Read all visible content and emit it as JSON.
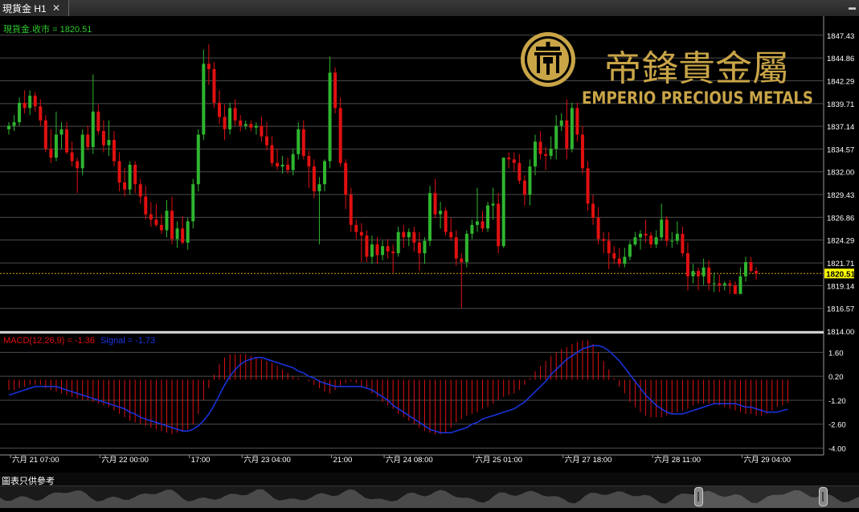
{
  "window": {
    "tab_title": "現貨金 H1",
    "close_glyph": "✕",
    "menu_glyph": "▬"
  },
  "price_panel": {
    "legend_label": "現貨金.收市 = 1820.51",
    "last_price_tag": "1820.51",
    "colors": {
      "up": "#2fb52f",
      "down": "#e01010",
      "grid": "#4d4d4d",
      "axis_text": "#ffffff",
      "last_line": "#d9a400",
      "tag_bg": "#ffff00"
    }
  },
  "logo": {
    "chinese": "帝鋒貴金屬",
    "english": "EMPERIO PRECIOUS METALS",
    "emblem_icon": "emperio-emblem-icon"
  },
  "macd_panel": {
    "legend_macd": "MACD(12,26,9) = -1.36",
    "legend_signal": "Signal = -1.73",
    "colors": {
      "histogram": "#e01010",
      "signal": "#1a35e6"
    }
  },
  "footer": {
    "disclaimer": "圖表只供參考"
  },
  "chart_data": [
    {
      "type": "candlestick",
      "title": "現貨金 H1",
      "y_ticks": [
        1814.0,
        1816.57,
        1819.14,
        1821.71,
        1824.29,
        1826.86,
        1829.43,
        1832.0,
        1834.57,
        1837.14,
        1839.71,
        1842.29,
        1844.86,
        1847.43
      ],
      "ylim": [
        1814.0,
        1848.5
      ],
      "last_price": 1820.51,
      "x_labels": [
        "六月 21 07:00",
        "六月 22 00:00",
        "17:00",
        "六月 23 04:00",
        "21:00",
        "六月 24 08:00",
        "六月 25 01:00",
        "六月 27 18:00",
        "六月 28 11:00",
        "六月 29 04:00"
      ],
      "x_label_index": [
        0,
        17,
        34,
        44,
        61,
        71,
        88,
        105,
        122,
        139
      ],
      "candles": [
        [
          1836.8,
          1837.6,
          1836.2,
          1837.2
        ],
        [
          1837.2,
          1838.4,
          1836.6,
          1837.6
        ],
        [
          1837.6,
          1840.4,
          1837.2,
          1839.8
        ],
        [
          1839.8,
          1841.2,
          1838.6,
          1839.2
        ],
        [
          1839.2,
          1841.2,
          1838.4,
          1840.6
        ],
        [
          1840.6,
          1841.0,
          1838.8,
          1839.4
        ],
        [
          1839.4,
          1840.2,
          1837.2,
          1837.8
        ],
        [
          1837.8,
          1838.4,
          1834.2,
          1834.6
        ],
        [
          1834.6,
          1836.8,
          1833.0,
          1833.6
        ],
        [
          1833.6,
          1838.8,
          1833.2,
          1836.2
        ],
        [
          1836.2,
          1837.6,
          1834.6,
          1836.8
        ],
        [
          1836.8,
          1837.6,
          1834.0,
          1834.2
        ],
        [
          1834.2,
          1835.4,
          1832.6,
          1833.2
        ],
        [
          1833.2,
          1833.6,
          1829.6,
          1832.4
        ],
        [
          1832.4,
          1836.8,
          1831.6,
          1836.2
        ],
        [
          1836.2,
          1837.2,
          1834.4,
          1834.8
        ],
        [
          1834.8,
          1843.0,
          1834.0,
          1838.8
        ],
        [
          1838.8,
          1839.6,
          1836.2,
          1836.6
        ],
        [
          1836.6,
          1837.8,
          1834.2,
          1835.0
        ],
        [
          1835.0,
          1837.8,
          1833.8,
          1835.6
        ],
        [
          1835.6,
          1836.6,
          1832.6,
          1833.2
        ],
        [
          1833.2,
          1834.2,
          1829.8,
          1830.8
        ],
        [
          1830.8,
          1832.4,
          1829.2,
          1830.0
        ],
        [
          1830.0,
          1833.2,
          1829.4,
          1832.8
        ],
        [
          1832.8,
          1833.2,
          1829.6,
          1830.6
        ],
        [
          1830.6,
          1831.2,
          1828.4,
          1829.2
        ],
        [
          1829.2,
          1830.4,
          1826.6,
          1827.2
        ],
        [
          1827.2,
          1828.6,
          1825.8,
          1826.6
        ],
        [
          1826.6,
          1828.4,
          1825.8,
          1826.0
        ],
        [
          1826.0,
          1827.2,
          1825.0,
          1825.4
        ],
        [
          1825.4,
          1828.8,
          1824.6,
          1827.6
        ],
        [
          1827.6,
          1829.2,
          1823.8,
          1824.4
        ],
        [
          1824.4,
          1826.4,
          1823.4,
          1825.6
        ],
        [
          1825.6,
          1827.0,
          1823.8,
          1824.0
        ],
        [
          1824.0,
          1826.8,
          1823.2,
          1826.4
        ],
        [
          1826.4,
          1831.2,
          1825.6,
          1830.6
        ],
        [
          1830.6,
          1836.8,
          1829.8,
          1836.2
        ],
        [
          1836.2,
          1845.8,
          1835.6,
          1844.2
        ],
        [
          1844.2,
          1846.4,
          1841.8,
          1843.6
        ],
        [
          1843.6,
          1844.4,
          1839.2,
          1839.8
        ],
        [
          1839.8,
          1841.2,
          1837.4,
          1838.2
        ],
        [
          1838.2,
          1839.6,
          1835.6,
          1836.8
        ],
        [
          1836.8,
          1839.8,
          1836.2,
          1839.2
        ],
        [
          1839.2,
          1840.2,
          1837.2,
          1837.8
        ],
        [
          1837.8,
          1838.4,
          1836.6,
          1837.2
        ],
        [
          1837.2,
          1837.8,
          1836.8,
          1837.4
        ],
        [
          1837.4,
          1837.8,
          1836.6,
          1837.0
        ],
        [
          1837.0,
          1837.6,
          1836.2,
          1837.2
        ],
        [
          1837.2,
          1838.2,
          1835.4,
          1836.0
        ],
        [
          1836.0,
          1837.6,
          1834.4,
          1835.0
        ],
        [
          1835.0,
          1836.0,
          1832.6,
          1833.0
        ],
        [
          1833.0,
          1834.6,
          1832.2,
          1832.6
        ],
        [
          1832.6,
          1833.8,
          1831.8,
          1832.8
        ],
        [
          1832.8,
          1833.6,
          1831.8,
          1832.2
        ],
        [
          1832.2,
          1834.6,
          1831.6,
          1834.0
        ],
        [
          1834.0,
          1837.6,
          1833.4,
          1836.8
        ],
        [
          1836.8,
          1837.8,
          1833.4,
          1833.8
        ],
        [
          1833.8,
          1834.4,
          1830.2,
          1832.6
        ],
        [
          1832.6,
          1833.4,
          1829.0,
          1829.8
        ],
        [
          1829.8,
          1831.4,
          1823.8,
          1830.6
        ],
        [
          1830.6,
          1833.4,
          1829.8,
          1833.2
        ],
        [
          1833.2,
          1845.0,
          1832.4,
          1843.2
        ],
        [
          1843.2,
          1843.8,
          1838.6,
          1839.2
        ],
        [
          1839.2,
          1840.4,
          1832.6,
          1833.0
        ],
        [
          1833.0,
          1833.4,
          1827.8,
          1829.4
        ],
        [
          1829.4,
          1830.2,
          1825.2,
          1826.0
        ],
        [
          1826.0,
          1826.6,
          1824.4,
          1825.2
        ],
        [
          1825.2,
          1826.2,
          1821.8,
          1824.8
        ],
        [
          1824.8,
          1825.4,
          1821.8,
          1822.4
        ],
        [
          1822.4,
          1824.8,
          1821.6,
          1823.8
        ],
        [
          1823.8,
          1824.6,
          1821.6,
          1822.6
        ],
        [
          1822.6,
          1824.2,
          1822.0,
          1823.6
        ],
        [
          1823.6,
          1824.4,
          1822.2,
          1823.0
        ],
        [
          1823.0,
          1823.8,
          1820.6,
          1822.8
        ],
        [
          1822.8,
          1825.8,
          1822.4,
          1825.2
        ],
        [
          1825.2,
          1826.0,
          1823.4,
          1824.6
        ],
        [
          1824.6,
          1825.6,
          1823.6,
          1825.2
        ],
        [
          1825.2,
          1825.8,
          1823.0,
          1824.0
        ],
        [
          1824.0,
          1825.2,
          1820.8,
          1822.8
        ],
        [
          1822.8,
          1824.6,
          1821.6,
          1824.2
        ],
        [
          1824.2,
          1830.4,
          1823.6,
          1829.6
        ],
        [
          1829.6,
          1831.2,
          1826.8,
          1827.2
        ],
        [
          1827.2,
          1828.6,
          1825.6,
          1827.6
        ],
        [
          1827.6,
          1828.0,
          1824.8,
          1825.2
        ],
        [
          1825.2,
          1826.8,
          1824.2,
          1824.6
        ],
        [
          1824.6,
          1825.4,
          1821.4,
          1822.2
        ],
        [
          1822.2,
          1822.8,
          1816.6,
          1821.8
        ],
        [
          1821.8,
          1825.4,
          1821.2,
          1825.0
        ],
        [
          1825.0,
          1826.6,
          1824.4,
          1826.0
        ],
        [
          1826.0,
          1830.2,
          1825.2,
          1826.4
        ],
        [
          1826.4,
          1827.6,
          1825.2,
          1825.6
        ],
        [
          1825.6,
          1828.6,
          1825.2,
          1828.2
        ],
        [
          1828.2,
          1830.2,
          1826.6,
          1828.4
        ],
        [
          1828.4,
          1829.6,
          1822.8,
          1823.6
        ],
        [
          1823.6,
          1833.6,
          1823.4,
          1833.6
        ],
        [
          1833.6,
          1834.2,
          1832.4,
          1833.4
        ],
        [
          1833.4,
          1834.2,
          1832.0,
          1833.0
        ],
        [
          1833.0,
          1834.0,
          1830.6,
          1831.0
        ],
        [
          1831.0,
          1831.6,
          1828.2,
          1829.4
        ],
        [
          1829.4,
          1833.4,
          1828.2,
          1832.6
        ],
        [
          1832.6,
          1836.2,
          1831.6,
          1835.4
        ],
        [
          1835.4,
          1836.6,
          1833.4,
          1834.0
        ],
        [
          1834.0,
          1834.8,
          1832.2,
          1833.8
        ],
        [
          1833.8,
          1836.0,
          1833.4,
          1834.6
        ],
        [
          1834.6,
          1838.4,
          1833.4,
          1837.2
        ],
        [
          1837.2,
          1838.6,
          1836.6,
          1837.8
        ],
        [
          1837.8,
          1840.2,
          1833.4,
          1834.6
        ],
        [
          1834.6,
          1839.8,
          1834.2,
          1839.2
        ],
        [
          1839.2,
          1839.8,
          1835.4,
          1836.2
        ],
        [
          1836.2,
          1837.2,
          1831.8,
          1832.4
        ],
        [
          1832.4,
          1833.2,
          1827.6,
          1828.4
        ],
        [
          1828.4,
          1829.4,
          1826.0,
          1826.8
        ],
        [
          1826.8,
          1828.0,
          1823.8,
          1824.4
        ],
        [
          1824.4,
          1825.2,
          1822.8,
          1824.2
        ],
        [
          1824.2,
          1825.2,
          1821.0,
          1822.8
        ],
        [
          1822.8,
          1823.6,
          1821.6,
          1822.2
        ],
        [
          1822.2,
          1823.4,
          1821.2,
          1821.6
        ],
        [
          1821.6,
          1823.4,
          1821.2,
          1822.4
        ],
        [
          1822.4,
          1824.2,
          1822.0,
          1823.8
        ],
        [
          1823.8,
          1825.2,
          1823.6,
          1824.6
        ],
        [
          1824.6,
          1825.4,
          1823.2,
          1825.0
        ],
        [
          1825.0,
          1826.6,
          1824.0,
          1824.8
        ],
        [
          1824.8,
          1825.2,
          1823.4,
          1823.8
        ],
        [
          1823.8,
          1825.4,
          1823.4,
          1824.6
        ],
        [
          1824.6,
          1828.4,
          1824.2,
          1826.6
        ],
        [
          1826.6,
          1827.0,
          1823.6,
          1824.2
        ],
        [
          1824.2,
          1825.2,
          1823.4,
          1824.2
        ],
        [
          1824.2,
          1826.4,
          1823.8,
          1825.0
        ],
        [
          1825.0,
          1825.8,
          1822.4,
          1822.8
        ],
        [
          1822.8,
          1824.0,
          1818.6,
          1820.2
        ],
        [
          1820.2,
          1821.6,
          1819.4,
          1820.8
        ],
        [
          1820.8,
          1821.2,
          1818.6,
          1820.2
        ],
        [
          1820.2,
          1822.2,
          1819.2,
          1821.2
        ],
        [
          1821.2,
          1822.0,
          1818.6,
          1819.4
        ],
        [
          1819.4,
          1820.6,
          1818.4,
          1819.4
        ],
        [
          1819.4,
          1820.4,
          1818.4,
          1819.2
        ],
        [
          1819.2,
          1819.6,
          1818.6,
          1819.4
        ],
        [
          1819.4,
          1819.8,
          1818.2,
          1819.2
        ],
        [
          1819.2,
          1819.6,
          1818.2,
          1818.2
        ],
        [
          1818.2,
          1821.2,
          1818.2,
          1820.2
        ],
        [
          1820.2,
          1822.4,
          1819.6,
          1821.8
        ],
        [
          1821.8,
          1822.4,
          1820.6,
          1820.8
        ],
        [
          1820.8,
          1821.2,
          1819.8,
          1820.51
        ]
      ]
    },
    {
      "type": "macd",
      "y_ticks": [
        1.6,
        0.2,
        -1.2,
        -2.6,
        -4.0
      ],
      "ylim": [
        -4.4,
        2.7
      ],
      "macd": [
        -0.6,
        -0.6,
        -0.5,
        -0.4,
        -0.3,
        -0.3,
        -0.3,
        -0.5,
        -0.6,
        -0.7,
        -0.8,
        -0.9,
        -1.0,
        -1.1,
        -1.2,
        -1.2,
        -1.3,
        -1.4,
        -1.5,
        -1.6,
        -1.8,
        -2.0,
        -2.2,
        -2.4,
        -2.5,
        -2.6,
        -2.7,
        -2.8,
        -2.9,
        -3.0,
        -3.1,
        -3.2,
        -3.1,
        -3.0,
        -2.9,
        -2.6,
        -2.0,
        -1.2,
        -0.5,
        0.3,
        0.9,
        1.3,
        1.5,
        1.5,
        1.5,
        1.5,
        1.4,
        1.3,
        1.2,
        1.1,
        1.0,
        0.8,
        0.6,
        0.4,
        0.2,
        0.1,
        0.0,
        -0.1,
        -0.3,
        -0.5,
        -0.7,
        -0.8,
        -0.6,
        -0.4,
        -0.2,
        -0.1,
        -0.2,
        -0.4,
        -0.5,
        -0.8,
        -1.0,
        -1.3,
        -1.5,
        -1.7,
        -2.0,
        -2.2,
        -2.4,
        -2.6,
        -2.8,
        -3.0,
        -3.1,
        -3.2,
        -3.2,
        -3.1,
        -2.8,
        -2.5,
        -2.3,
        -2.1,
        -2.0,
        -1.9,
        -1.7,
        -1.6,
        -1.4,
        -1.2,
        -1.0,
        -0.9,
        -0.8,
        -0.6,
        -0.3,
        0.1,
        0.5,
        0.8,
        1.1,
        1.4,
        1.6,
        1.8,
        1.9,
        2.1,
        2.2,
        2.3,
        2.3,
        2.1,
        1.6,
        1.1,
        0.6,
        0.1,
        -0.4,
        -0.8,
        -1.3,
        -1.6,
        -1.9,
        -2.1,
        -2.2,
        -2.2,
        -2.2,
        -2.1,
        -2.0,
        -1.9,
        -1.8,
        -1.7,
        -1.5,
        -1.4,
        -1.4,
        -1.4,
        -1.4,
        -1.5,
        -1.6,
        -1.7,
        -1.8,
        -1.9,
        -2.0,
        -2.0,
        -2.1,
        -2.1,
        -2.0,
        -1.8,
        -1.6,
        -1.5,
        -1.36
      ],
      "signal": [
        -0.9,
        -0.8,
        -0.7,
        -0.6,
        -0.5,
        -0.4,
        -0.4,
        -0.4,
        -0.4,
        -0.4,
        -0.5,
        -0.6,
        -0.7,
        -0.8,
        -0.9,
        -1.0,
        -1.1,
        -1.2,
        -1.3,
        -1.4,
        -1.5,
        -1.6,
        -1.7,
        -1.9,
        -2.0,
        -2.2,
        -2.3,
        -2.4,
        -2.5,
        -2.6,
        -2.7,
        -2.8,
        -2.9,
        -3.0,
        -3.0,
        -2.9,
        -2.7,
        -2.4,
        -2.0,
        -1.5,
        -0.9,
        -0.3,
        0.2,
        0.6,
        0.9,
        1.1,
        1.2,
        1.3,
        1.3,
        1.2,
        1.1,
        1.0,
        0.9,
        0.8,
        0.7,
        0.5,
        0.4,
        0.2,
        0.1,
        -0.1,
        -0.2,
        -0.3,
        -0.4,
        -0.4,
        -0.4,
        -0.4,
        -0.4,
        -0.4,
        -0.5,
        -0.6,
        -0.8,
        -1.0,
        -1.2,
        -1.5,
        -1.7,
        -1.9,
        -2.1,
        -2.3,
        -2.5,
        -2.7,
        -2.9,
        -3.0,
        -3.1,
        -3.1,
        -3.1,
        -3.0,
        -2.9,
        -2.8,
        -2.6,
        -2.5,
        -2.3,
        -2.2,
        -2.1,
        -2.0,
        -1.9,
        -1.8,
        -1.7,
        -1.5,
        -1.3,
        -1.0,
        -0.7,
        -0.4,
        -0.1,
        0.3,
        0.6,
        0.9,
        1.2,
        1.4,
        1.6,
        1.8,
        1.9,
        2.0,
        2.0,
        1.9,
        1.7,
        1.4,
        1.1,
        0.7,
        0.3,
        -0.1,
        -0.5,
        -0.9,
        -1.2,
        -1.5,
        -1.7,
        -1.9,
        -2.0,
        -2.0,
        -2.0,
        -1.9,
        -1.8,
        -1.7,
        -1.6,
        -1.5,
        -1.4,
        -1.4,
        -1.4,
        -1.4,
        -1.4,
        -1.5,
        -1.6,
        -1.6,
        -1.7,
        -1.8,
        -1.9,
        -1.9,
        -1.9,
        -1.8,
        -1.73
      ]
    }
  ]
}
